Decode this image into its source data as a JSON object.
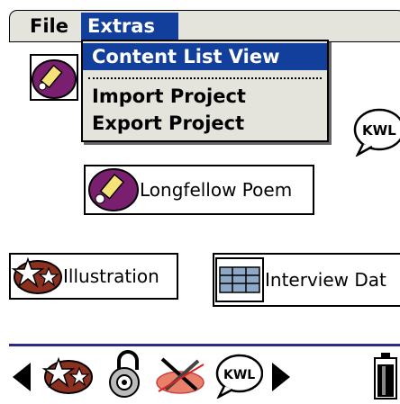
{
  "menubar": {
    "file_label": "File",
    "extras_label": "Extras"
  },
  "dropdown": {
    "items": [
      {
        "label": "Content List View",
        "selected": true
      },
      {
        "label": "Import Project",
        "selected": false
      },
      {
        "label": "Export Project",
        "selected": false
      }
    ]
  },
  "canvas": {
    "items": [
      {
        "label": "Longfellow Poem",
        "icon": "pencil-icon"
      },
      {
        "label": "Illustration",
        "icon": "star-football-icon"
      },
      {
        "label": "Interview Dat",
        "icon": "table-icon"
      },
      {
        "label": "",
        "icon": "pencil-icon"
      },
      {
        "label": "KWL",
        "icon": "kwl-icon"
      }
    ]
  },
  "toolbar": {
    "kwl_text": "KWL",
    "icons": [
      "left-arrow-icon",
      "star-football-icon",
      "gear-lock-icon",
      "crossed-tools-icon",
      "kwl-icon",
      "right-arrow-icon",
      "battery-icon"
    ]
  },
  "colors": {
    "selection": "#123f9c",
    "menu_bg": "#e4e4dc",
    "divider": "#2a2a8a",
    "pencil_bg": "#7a1f6f"
  }
}
